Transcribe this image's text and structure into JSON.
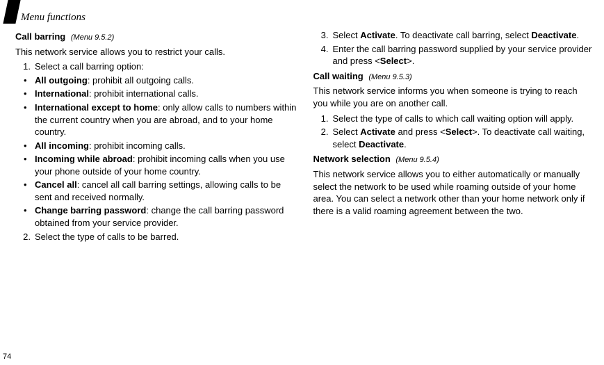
{
  "page_number": "74",
  "header": "Menu functions",
  "left": {
    "call_barring": {
      "title": "Call barring",
      "menu": "(Menu 9.5.2)",
      "intro": "This network service allows you to restrict your calls.",
      "step1_num": "1.",
      "step1_text": "Select a call barring option:",
      "bul1_label": "All outgoing",
      "bul1_rest": ": prohibit all outgoing calls.",
      "bul2_label": "International",
      "bul2_rest": ": prohibit international calls.",
      "bul3_label": "International except to home",
      "bul3_rest": ": only allow calls to numbers within the current country when you are abroad, and to your home country.",
      "bul4_label": "All incoming",
      "bul4_rest": ": prohibit incoming calls.",
      "bul5_label": "Incoming while abroad",
      "bul5_rest": ": prohibit incoming calls when you use your phone outside of your home country.",
      "bul6_label": "Cancel all",
      "bul6_rest": ": cancel all call barring settings, allowing calls to be sent and received normally.",
      "bul7_label": "Change barring password",
      "bul7_rest": ": change the call barring password obtained from your service provider.",
      "step2_num": "2.",
      "step2_text": "Select the type of calls to be barred."
    }
  },
  "right": {
    "call_barring_cont": {
      "step3_num": "3.",
      "step3_a": "Select ",
      "step3_b": "Activate",
      "step3_c": ". To deactivate call barring, select ",
      "step3_d": "Deactivate",
      "step3_e": ".",
      "step4_num": "4.",
      "step4_a": "Enter the call barring password supplied by your service provider and press <",
      "step4_b": "Select",
      "step4_c": ">."
    },
    "call_waiting": {
      "title": "Call waiting",
      "menu": "(Menu 9.5.3)",
      "intro": "This network service informs you when someone is trying to reach you while you are on another call.",
      "step1_num": "1.",
      "step1_text": "Select the type of calls to which call waiting option will apply.",
      "step2_num": "2.",
      "step2_a": "Select ",
      "step2_b": "Activate",
      "step2_c": " and press <",
      "step2_d": "Select",
      "step2_e": ">. To deactivate call waiting, select ",
      "step2_f": "Deactivate",
      "step2_g": "."
    },
    "network_selection": {
      "title": "Network selection",
      "menu": "(Menu 9.5.4)",
      "intro": "This network service allows you to either automatically or manually select the network to be used while roaming outside of your home area. You can select a network other than your home network only if there is a valid roaming agreement between the two."
    }
  }
}
